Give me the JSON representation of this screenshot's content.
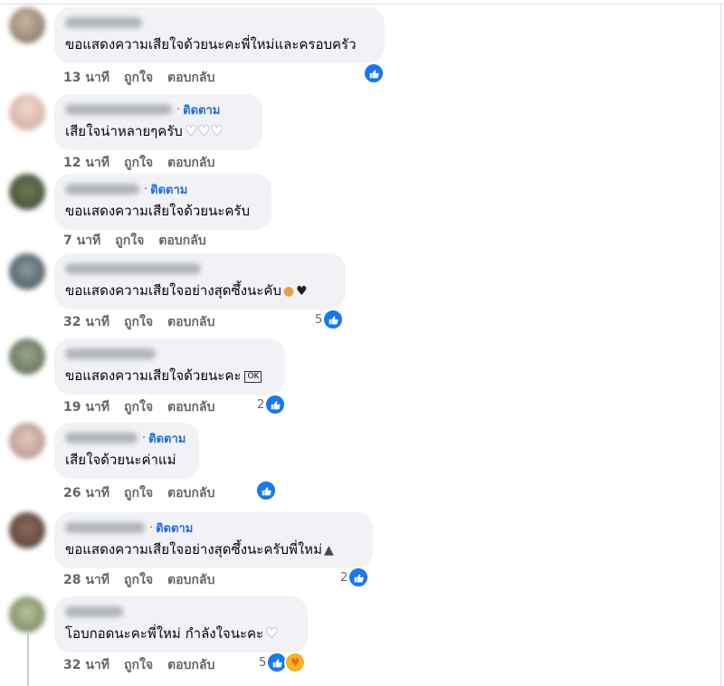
{
  "colors": {
    "bubble": "#f0f2f5",
    "meta": "#65676b",
    "follow": "#216fdb",
    "like": "#1877f2"
  },
  "actions": {
    "like": "ถูกใจ",
    "reply": "ตอบกลับ"
  },
  "follow_label": "ติดตาม",
  "follow_dot": "·",
  "comments": [
    {
      "text": "ขอแสดงความเสียใจด้วยนะคะพี่ใหม่และครอบครัว",
      "time": "13 นาที",
      "reactions": ""
    },
    {
      "text": "เสียใจน่าหลายๆครับ",
      "time": "12 นาที",
      "reactions": ""
    },
    {
      "text": "ขอแสดงความเสียใจด้วยนะครับ",
      "time": "7 นาที",
      "reactions": ""
    },
    {
      "text": "ขอแสดงความเสียใจอย่างสุดซึ้งนะคับ",
      "time": "32 นาที",
      "reactions": "5"
    },
    {
      "text": "ขอแสดงความเสียใจด้วยนะคะ",
      "time": "19 นาที",
      "reactions": "2"
    },
    {
      "text": "เสียใจด้วยนะค่าแม่",
      "time": "26 นาที",
      "reactions": ""
    },
    {
      "text": "ขอแสดงความเสียใจอย่างสุดซึ้งนะครับพี่ใหม่",
      "time": "28 นาที",
      "reactions": "2"
    },
    {
      "text": "โอบกอดนะคะพี่ใหม่ กำลังใจนะคะ",
      "time": "32 นาที",
      "reactions": "5"
    }
  ],
  "inline_glyphs": {
    "ok": "OK"
  },
  "icons": {
    "like": "thumbs-up-icon",
    "care": "care-icon",
    "heart": "white-heart-icon"
  }
}
